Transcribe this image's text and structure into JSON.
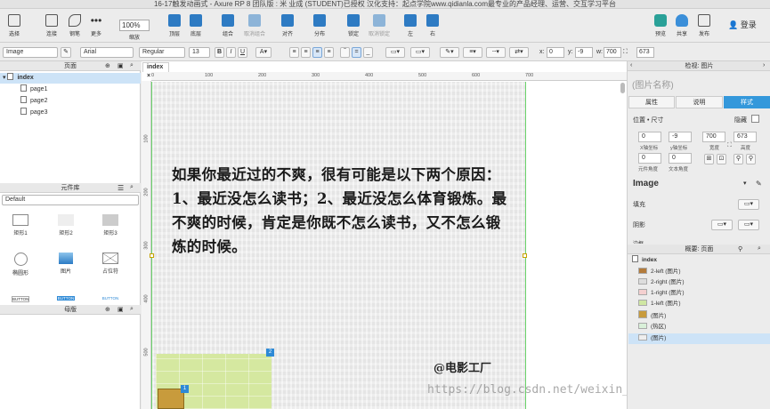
{
  "window": {
    "title": "16-17触发动画式 - Axure RP 8 团队版 : 米 业成 (STUDENT)已授权 汉化支持：起点学院www.qidianla.com最专业的产品经理、运营、交互学习平台"
  },
  "toolbar": {
    "select": "选择",
    "connect": "连接",
    "pen": "钢笔",
    "more": "更多",
    "zoom_value": "100%",
    "zoom_label": "缩放",
    "top": "顶层",
    "bottom": "底层",
    "group": "组合",
    "ungroup": "取消组合",
    "align": "对齐",
    "distribute": "分布",
    "lock": "锁定",
    "unlock": "取消锁定",
    "left": "左",
    "right": "右",
    "preview": "预览",
    "share": "共享",
    "publish": "发布",
    "login": "登录"
  },
  "format": {
    "style": "Image",
    "font": "Arial",
    "weight": "Regular",
    "size": "13",
    "bold": "B",
    "italic": "I",
    "underline": "U",
    "x_label": "x:",
    "x": "0",
    "y_label": "y:",
    "y": "-9",
    "w_label": "w:",
    "w": "700",
    "h": "673"
  },
  "pages": {
    "header": "页面",
    "items": [
      {
        "label": "index"
      },
      {
        "label": "page1"
      },
      {
        "label": "page2"
      },
      {
        "label": "page3"
      }
    ]
  },
  "library": {
    "header": "元件库",
    "selected": "Default",
    "widgets": [
      {
        "label": "矩形1"
      },
      {
        "label": "矩形2"
      },
      {
        "label": "矩形3"
      },
      {
        "label": "椭圆形"
      },
      {
        "label": "图片"
      },
      {
        "label": "占位符"
      },
      {
        "label": "BUTTON"
      },
      {
        "label": "BUTTON"
      },
      {
        "label": "BUTTON"
      }
    ]
  },
  "masters": {
    "header": "母版"
  },
  "canvas": {
    "tab": "index",
    "ruler_h": [
      "0",
      "100",
      "200",
      "300",
      "400",
      "500",
      "600",
      "700"
    ],
    "ruler_v": [
      "100",
      "200",
      "300",
      "400",
      "500"
    ],
    "quote": "如果你最近过的不爽，很有可能是以下两个原因：1、最近没怎么读书；2、最近没怎么体育锻炼。最不爽的时候，肯定是你既不怎么读书，又不怎么锻炼的时候。",
    "credit": "@电影工厂",
    "badge_1": "1",
    "badge_2": "2",
    "watermark": "https://blog.csdn.net/weixin_40845074"
  },
  "inspector": {
    "header": "检视: 图片",
    "name_placeholder": "(图片名称)",
    "tabs": [
      {
        "label": "属性"
      },
      {
        "label": "说明"
      },
      {
        "label": "样式"
      }
    ],
    "pos_size": "位置 • 尺寸",
    "hide": "隐藏",
    "x": "0",
    "y": "-9",
    "w": "700",
    "h": "673",
    "x_lbl": "X轴坐标",
    "y_lbl": "y轴坐标",
    "w_lbl": "宽度",
    "h_lbl": "高度",
    "rot1": "0",
    "rot2": "0",
    "rot1_lbl": "元件角度",
    "rot2_lbl": "文本角度",
    "hidden2": "隐藏",
    "style": "Image",
    "fill": "填充",
    "shadow": "阴影",
    "border": "边框"
  },
  "outline": {
    "header": "概要: 页面",
    "root": "index",
    "items": [
      {
        "label": "2-left (图片)"
      },
      {
        "label": "2-right (图片)"
      },
      {
        "label": "1-right (图片)"
      },
      {
        "label": "1-left (图片)"
      },
      {
        "label": "(图片)"
      },
      {
        "label": "(热区)"
      },
      {
        "label": "(图片)"
      }
    ]
  }
}
